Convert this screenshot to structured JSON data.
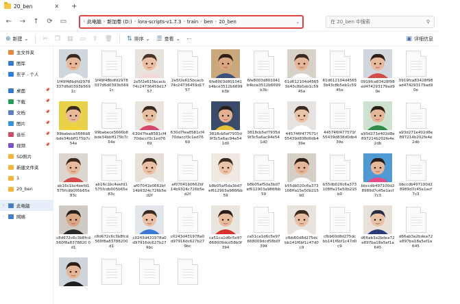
{
  "window": {
    "tab_title": "20_ben",
    "tab_close": "✕",
    "tab_add": "+"
  },
  "address": {
    "segments": [
      "此电脑",
      "新加卷 (D:)",
      "lora-scripts-v1.7.3",
      "train",
      "ben",
      "20_ben"
    ]
  },
  "search": {
    "placeholder": "在 20_ben 中搜索"
  },
  "toolbar": {
    "new_label": "新建",
    "sort_label": "排序",
    "view_label": "查看",
    "details_label": "详细信息"
  },
  "sidebar": {
    "items": [
      {
        "label": "主文件夹",
        "color": "#e08a3c",
        "pin": ""
      },
      {
        "label": "图库",
        "color": "#3a78c9",
        "pin": ""
      },
      {
        "label": "东子 - 个人",
        "color": "#2f7de1",
        "pin": "",
        "chev": "›"
      },
      {
        "label": "桌面",
        "color": "#3a78c9",
        "pin": "📌"
      },
      {
        "label": "下载",
        "color": "#2a9a5a",
        "pin": "📌"
      },
      {
        "label": "文档",
        "color": "#5b7fbf",
        "pin": "📌"
      },
      {
        "label": "图片",
        "color": "#3a8fd9",
        "pin": "📌"
      },
      {
        "label": "音乐",
        "color": "#d04a6a",
        "pin": "📌"
      },
      {
        "label": "视频",
        "color": "#7b4fc9",
        "pin": "📌"
      },
      {
        "label": "SD照片",
        "color": "#f2b93b",
        "pin": ""
      },
      {
        "label": "新建文件夹",
        "color": "#f2b93b",
        "pin": ""
      },
      {
        "label": "1",
        "color": "#f2b93b",
        "pin": ""
      },
      {
        "label": "20_ben",
        "color": "#f2b93b",
        "pin": ""
      },
      {
        "label": "此电脑",
        "color": "#4a7fc1",
        "pin": "",
        "chev": "›",
        "selected": true
      },
      {
        "label": "网络",
        "color": "#4a7fc1",
        "pin": "",
        "chev": "›"
      }
    ]
  },
  "files": [
    {
      "name": "1f49f48bdfd2978337d6d0393b5691c",
      "kind": "photo",
      "bg": "#cfd6dc",
      "skin": "#e9b89a",
      "hair": "#3a2a20",
      "shirt": "#ffffff"
    },
    {
      "name": "1f49f48bdfd2978337d6d0393b5691c",
      "kind": "doc"
    },
    {
      "name": "2e5f2e615bcacb74c24736459d1757",
      "kind": "photo",
      "bg": "#e7e2dc",
      "skin": "#eac0a4",
      "hair": "#4a3426",
      "shirt": "#f4d7d7"
    },
    {
      "name": "2e5f2e615bcacb74c24736459d1757",
      "kind": "doc"
    },
    {
      "name": "6fe8003d801041b4bce3512b6699b3b",
      "kind": "photo",
      "bg": "#c9a87c",
      "skin": "#d9a784",
      "hair": "#2e2018",
      "shirt": "#3d4f7a"
    },
    {
      "name": "6fe8003d801041b4bce3512b6699b3b",
      "kind": "doc"
    },
    {
      "name": "61d612104d45653b43c8b5eb1c5945e",
      "kind": "photo",
      "bg": "#d8d1c8",
      "skin": "#e6b597",
      "hair": "#3a2a20",
      "shirt": "#ffffff"
    },
    {
      "name": "61d612104d45653b43c8b5eb1c5945e",
      "kind": "doc"
    },
    {
      "name": "0919fca83428f98ad474293179ad90e",
      "kind": "photo",
      "bg": "#d2d7de",
      "skin": "#e8bb9d",
      "hair": "#2c1e16",
      "shirt": "#d24a4a"
    },
    {
      "name": "0919fca83428f98ad474293179ad90e",
      "kind": "doc"
    },
    {
      "name": "99babece5666b8bde34bbff175b7c54e",
      "kind": "photo",
      "bg": "#e8d24a",
      "skin": "#e9b89a",
      "hair": "#3a2a20",
      "shirt": "#f2d23a"
    },
    {
      "name": "99babece5666b8bde34bbff175b7c54e",
      "kind": "doc"
    },
    {
      "name": "630d7fea8581cf470daccf3c1ed7669",
      "kind": "photo",
      "bg": "#eae4de",
      "skin": "#e8bea1",
      "hair": "#3c2a20",
      "shirt": "#d6456a"
    },
    {
      "name": "630d7fea8581cf470daccf3c1ed7669",
      "kind": "doc"
    },
    {
      "name": "3818cb5ef7935d9f3c5a6ac94e541d0",
      "kind": "photo",
      "bg": "#3a4a6a",
      "skin": "#e3b090",
      "hair": "#2a1e18",
      "shirt": "#e6c23a"
    },
    {
      "name": "3818cb5ef7935d9f3c5a6ac94e541d0",
      "kind": "doc"
    },
    {
      "name": "445746f477571f55439d838d0db439e",
      "kind": "photo",
      "bg": "#e5e2df",
      "skin": "#eac2a6",
      "hair": "#3a2a20",
      "shirt": "#ffffff"
    },
    {
      "name": "445746f477571f55439d838d0db439e",
      "kind": "doc"
    },
    {
      "name": "a93d271e402d8e897214b202fe4e2db",
      "kind": "photo",
      "bg": "#cfe1cf",
      "skin": "#e6b597",
      "hair": "#2c1e16",
      "shirt": "#2f8a4a"
    },
    {
      "name": "a93d271e402d8e897214b202fe4e2db",
      "kind": "doc"
    },
    {
      "name": "ab16c1bc4eefd1575fcdb005b65e83c",
      "kind": "photo",
      "bg": "#dcd6d0",
      "skin": "#e8b99b",
      "hair": "#3a2a20",
      "shirt": "#d84a4a"
    },
    {
      "name": "ab16c1bc4eefd1575fcdb005b65e83c",
      "kind": "doc"
    },
    {
      "name": "af07041b0662bf14b9324c726b5ed2f",
      "kind": "photo",
      "bg": "#e6e0d8",
      "skin": "#eac0a4",
      "hair": "#3e2c22",
      "shirt": "#ffffff"
    },
    {
      "name": "af07041b0662bf14b9324c726b5ed2f",
      "kind": "doc"
    },
    {
      "name": "b8b05af5da3bd7ef612903a986fbb59",
      "kind": "photo",
      "bg": "#efe9e2",
      "skin": "#ebc3a7",
      "hair": "#3a2a20",
      "shirt": "#f1ece6"
    },
    {
      "name": "b8b05af5da3bd7ef612903a986fbb59",
      "kind": "doc"
    },
    {
      "name": "b55db020c6a373108ffa15e50b215b0",
      "kind": "photo",
      "bg": "#d6cfc6",
      "skin": "#e6b597",
      "hair": "#2e2018",
      "shirt": "#ffffff"
    },
    {
      "name": "b55db020c6a373108ffa15e50b215b0",
      "kind": "doc"
    },
    {
      "name": "bbccdb497100d28989d7c45e1acf7c3",
      "kind": "photo",
      "bg": "#4f9ad2",
      "skin": "#e9b89a",
      "hair": "#2c1e16",
      "shirt": "#e84a8a"
    },
    {
      "name": "bbccdb497100d28989d7c45e1acf7c3",
      "kind": "doc"
    },
    {
      "name": "c8d672c6c3b8fcd560f8a8378820 0d1",
      "kind": "photo",
      "bg": "#cfcac4",
      "skin": "#d9a784",
      "hair": "#2a1e18",
      "shirt": "#2a2a2a"
    },
    {
      "name": "c8d672c6c3b8fcd560f8a83788200d1",
      "kind": "doc"
    },
    {
      "name": "c0243d431978a0d97916dc627b279bc",
      "kind": "photo",
      "bg": "#e2e6ea",
      "skin": "#eac0a4",
      "hair": "#3a2a20",
      "shirt": "#3a7ad6"
    },
    {
      "name": "c0243d431978a0d97916dc627b279bc",
      "kind": "doc"
    },
    {
      "name": "ca51ca1d6c5e97668009dcd58b0f394",
      "kind": "photo",
      "bg": "#e9e4de",
      "skin": "#e8bb9d",
      "hair": "#2c1e16",
      "shirt": "#d8322e"
    },
    {
      "name": "ca51ca1d6c5e97668009dcd58b0f394",
      "kind": "doc"
    },
    {
      "name": "cfbb60d8d275dcbb141f6bf1c47d0c9",
      "kind": "photo",
      "bg": "#e8e3dc",
      "skin": "#e9bd9f",
      "hair": "#3a2a20",
      "shirt": "#ffffff"
    },
    {
      "name": "cfbb60d8d275dcbb141f6bf1c47d0c9",
      "kind": "doc"
    },
    {
      "name": "d66ab3a2bdea72e897ba18a5ef1a645",
      "kind": "photo",
      "bg": "#e7e1da",
      "skin": "#eac2a6",
      "hair": "#2a2a40",
      "shirt": "#2a3a7a"
    },
    {
      "name": "d66ab3a2bdea72e897ba18a5ef1a645",
      "kind": "doc"
    },
    {
      "name": "",
      "kind": "photo",
      "bg": "#cfd3da",
      "skin": "#e6b597",
      "hair": "#2c1e16",
      "shirt": "#1e1e1e"
    },
    {
      "name": "",
      "kind": "doc"
    },
    {
      "name": "",
      "kind": "doc"
    },
    {
      "name": "",
      "kind": "doc"
    }
  ]
}
